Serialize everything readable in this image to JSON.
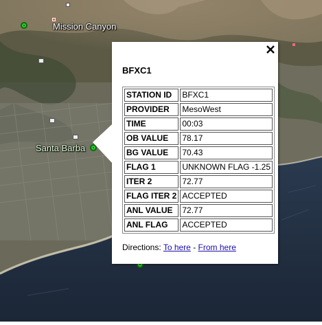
{
  "map": {
    "labels": {
      "mission_canyon": "Mission Canyon",
      "santa_barbara": "Santa Barba"
    }
  },
  "balloon": {
    "title": "BFXC1",
    "close_icon": "close-x-icon",
    "rows": [
      {
        "key": "STATION ID",
        "value": "BFXC1"
      },
      {
        "key": "PROVIDER",
        "value": "MesoWest"
      },
      {
        "key": "TIME",
        "value": "00:03"
      },
      {
        "key": "OB VALUE",
        "value": "78.17"
      },
      {
        "key": "BG VALUE",
        "value": "70.43"
      },
      {
        "key": "FLAG 1",
        "value": "UNKNOWN FLAG -1.25"
      },
      {
        "key": "ITER 2",
        "value": "72.77"
      },
      {
        "key": "FLAG ITER 2",
        "value": "ACCEPTED"
      },
      {
        "key": "ANL VALUE",
        "value": "72.77"
      },
      {
        "key": "ANL FLAG",
        "value": "ACCEPTED"
      }
    ],
    "directions": {
      "label": "Directions:",
      "to_here": "To here",
      "separator": "-",
      "from_here": "From here"
    }
  },
  "colors": {
    "link": "#1a0dab",
    "marker": "#2fd12f",
    "ocean": "#1e2b3d"
  }
}
